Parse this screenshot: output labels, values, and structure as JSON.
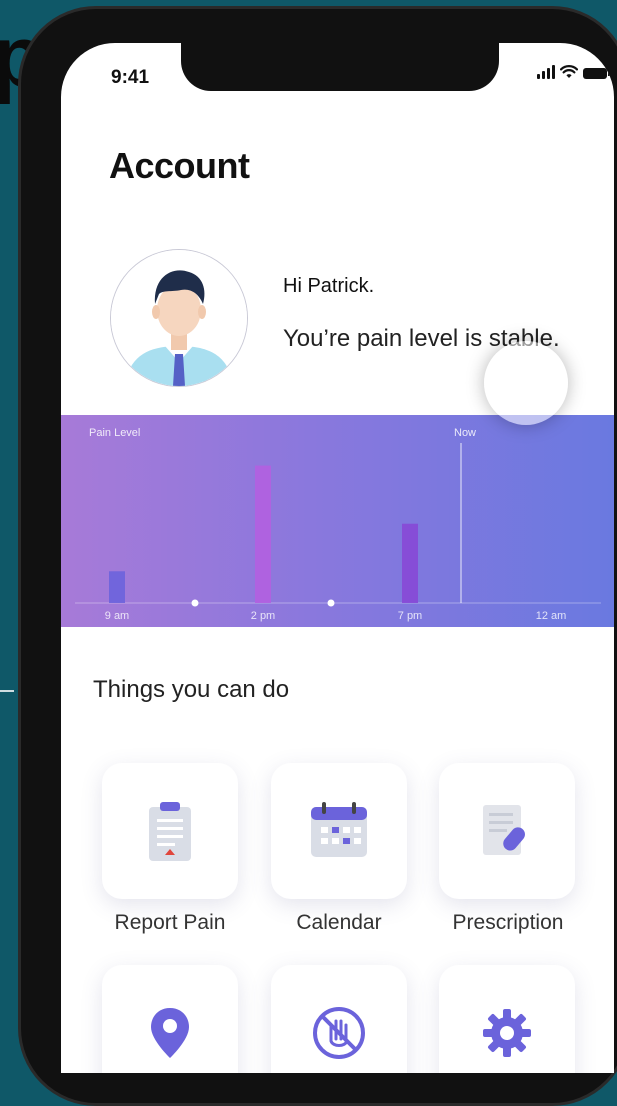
{
  "status_bar": {
    "time": "9:41"
  },
  "header": {
    "title": "Account"
  },
  "profile": {
    "greeting": "Hi Patrick.",
    "status_message": "You’re pain level is stable."
  },
  "pain_chart": {
    "label": "Pain Level",
    "now_label": "Now",
    "colors": {
      "bar_blue": "#6b63db",
      "bar_pink": "#b25fe0",
      "bar_violet": "#8748d6"
    }
  },
  "chart_data": {
    "type": "bar",
    "categories": [
      "9 am",
      "2 pm",
      "7 pm",
      "12 am"
    ],
    "values": [
      3,
      13,
      7.5,
      0
    ],
    "ylabel": "Pain Level",
    "ylim": [
      0,
      14
    ],
    "markers": [
      "Now"
    ]
  },
  "actions": {
    "title": "Things you can do",
    "items": [
      {
        "label": "Report Pain",
        "icon": "clipboard-icon"
      },
      {
        "label": "Calendar",
        "icon": "calendar-icon"
      },
      {
        "label": "Prescription",
        "icon": "pill-prescription-icon"
      },
      {
        "label": "",
        "icon": "location-pin-icon"
      },
      {
        "label": "",
        "icon": "no-touch-icon"
      },
      {
        "label": "",
        "icon": "gear-icon"
      }
    ]
  },
  "theme": {
    "accent": "#6b63db",
    "chart_start": "#a77ad8",
    "chart_end": "#6a79e0",
    "background": "#0f5868"
  }
}
